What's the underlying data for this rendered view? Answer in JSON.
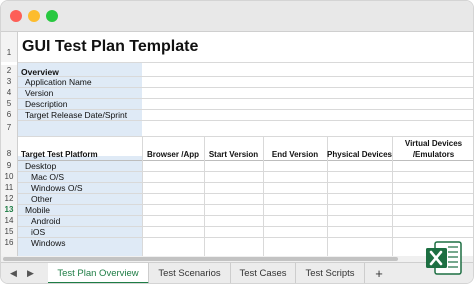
{
  "title": "GUI Test Plan Template",
  "rows": [
    "1",
    "2",
    "3",
    "4",
    "5",
    "6",
    "7",
    "8",
    "9",
    "10",
    "11",
    "12",
    "13",
    "14",
    "15",
    "16"
  ],
  "active_row": "13",
  "overview": {
    "heading": "Overview",
    "items": [
      "Application Name",
      "Version",
      "Description",
      "Target Release Date/Sprint"
    ]
  },
  "table": {
    "columns": [
      "Target Test Platform",
      "Browser /App",
      "Start Version",
      "End Version",
      "Physical Devices",
      "Virtual Devices /Emulators"
    ],
    "virtual_line1": "Virtual Devices",
    "virtual_line2": "/Emulators",
    "platforms": [
      "Desktop",
      "Mac O/S",
      "Windows O/S",
      "Other",
      "Mobile",
      "Android",
      "iOS",
      "Windows"
    ]
  },
  "tabs": [
    "Test Plan Overview",
    "Test Scenarios",
    "Test Cases",
    "Test Scripts"
  ],
  "active_tab": "Test Plan Overview",
  "add_tab_label": "+",
  "nav": {
    "prev": "◀",
    "next": "▶"
  },
  "colors": {
    "accent": "#1e7d45",
    "input_fill": "#dfeaf6",
    "excel_green": "#1d6f42"
  },
  "icons": {
    "excel": "excel-icon"
  }
}
